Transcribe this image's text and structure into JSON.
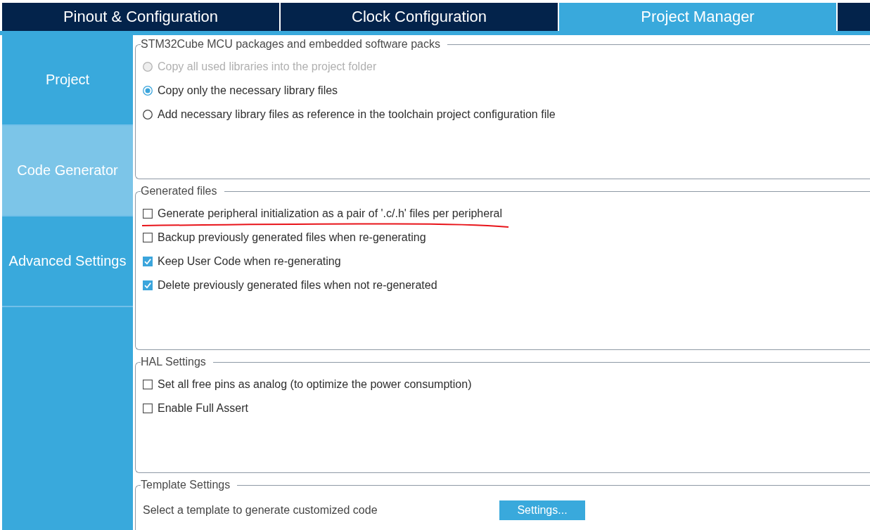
{
  "tabs": [
    {
      "label": "Pinout & Configuration",
      "selected": false
    },
    {
      "label": "Clock Configuration",
      "selected": false
    },
    {
      "label": "Project Manager",
      "selected": true
    }
  ],
  "sidebar": {
    "items": [
      {
        "label": "Project",
        "selected": false
      },
      {
        "label": "Code Generator",
        "selected": true
      },
      {
        "label": "Advanced Settings",
        "selected": false
      }
    ]
  },
  "groups": [
    {
      "title": "STM32Cube MCU packages and embedded software packs",
      "options": [
        {
          "kind": "radio",
          "label": "Copy all used libraries into the project folder",
          "selected": false,
          "disabled": true
        },
        {
          "kind": "radio",
          "label": "Copy only the necessary library files",
          "selected": true,
          "disabled": false
        },
        {
          "kind": "radio",
          "label": "Add necessary library files as reference in the toolchain project configuration file",
          "selected": false,
          "disabled": false
        }
      ]
    },
    {
      "title": "Generated files",
      "options": [
        {
          "kind": "checkbox",
          "label": "Generate peripheral initialization as a pair of '.c/.h' files per peripheral",
          "checked": false,
          "underlined": true
        },
        {
          "kind": "checkbox",
          "label": "Backup previously generated files when re-generating",
          "checked": false,
          "underlined": false
        },
        {
          "kind": "checkbox",
          "label": "Keep User Code when re-generating",
          "checked": true,
          "underlined": false
        },
        {
          "kind": "checkbox",
          "label": "Delete previously generated files when not re-generated",
          "checked": true,
          "underlined": false
        }
      ]
    },
    {
      "title": "HAL Settings",
      "options": [
        {
          "kind": "checkbox",
          "label": "Set all free pins as analog (to optimize the power consumption)",
          "checked": false,
          "underlined": false
        },
        {
          "kind": "checkbox",
          "label": "Enable Full Assert",
          "checked": false,
          "underlined": false
        }
      ]
    }
  ],
  "template_settings": {
    "title": "Template Settings",
    "text": "Select a template to generate customized code",
    "button": "Settings..."
  }
}
